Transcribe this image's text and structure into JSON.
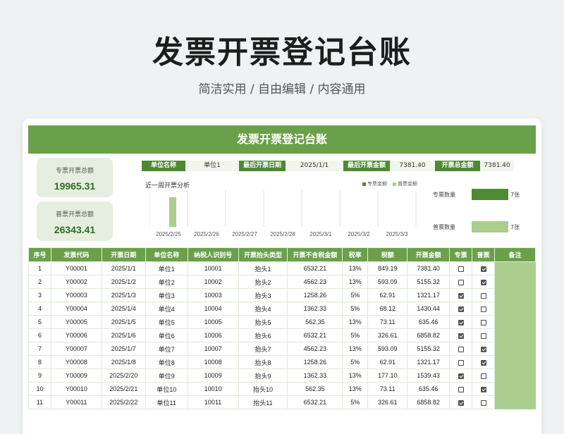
{
  "page": {
    "title": "发票开票登记台账",
    "subtitle": "简洁实用 / 自由编辑 / 内容通用"
  },
  "card": {
    "header": "发票开票登记台账",
    "summary": [
      {
        "label": "专票开票总额",
        "value": "19965.31"
      },
      {
        "label": "普票开票总额",
        "value": "26343.41"
      }
    ],
    "info": [
      {
        "key": "单位名称",
        "value": "单位1"
      },
      {
        "key": "最后开票日期",
        "value": "2025/1/1"
      },
      {
        "key": "最后开票金额",
        "value": "7381.40"
      },
      {
        "key": "开票总金额",
        "value": "7381.40"
      }
    ],
    "stats": [
      {
        "label": "专票数量",
        "value": "7张",
        "count": 7
      },
      {
        "label": "普票数量",
        "value": "7张",
        "count": 7
      }
    ]
  },
  "colors": {
    "header_green": "#6aa04a",
    "dark_green": "#4e8a34",
    "light_green": "#a9ce8d",
    "pale_green": "#e6efdf"
  },
  "chart_data": {
    "type": "bar",
    "title": "近一周开票分析",
    "categories": [
      "2025/2/25",
      "2025/2/26",
      "2025/2/27",
      "2025/2/28",
      "2025/3/1",
      "2025/3/2",
      "2025/3/3"
    ],
    "series": [
      {
        "name": "专票金额",
        "color": "#4e8a34",
        "values": [
          0,
          0,
          0,
          0,
          0,
          0,
          0
        ]
      },
      {
        "name": "普票金额",
        "color": "#a9ce8d",
        "values": [
          1,
          0,
          0,
          0,
          0,
          0,
          0
        ]
      }
    ],
    "ylim": [
      0,
      1
    ],
    "grid": true,
    "legend": "top-right"
  },
  "table": {
    "headers": [
      "序号",
      "发票代码",
      "开票日期",
      "单位名称",
      "纳税人识别号",
      "开票抬头类型",
      "开票不含税金额",
      "税率",
      "税额",
      "开票金额",
      "专票",
      "普票",
      "备注"
    ],
    "rows": [
      {
        "no": "1",
        "code": "Y00001",
        "date": "2025/1/1",
        "unit": "单位1",
        "tax_id": "10001",
        "head": "抬头1",
        "amount_ex": "6532.21",
        "rate": "13%",
        "tax": "849.19",
        "amount": "7381.40",
        "special": false,
        "normal": true,
        "note": ""
      },
      {
        "no": "2",
        "code": "Y00002",
        "date": "2025/1/2",
        "unit": "单位2",
        "tax_id": "10002",
        "head": "抬头2",
        "amount_ex": "4562.23",
        "rate": "13%",
        "tax": "593.09",
        "amount": "5155.32",
        "special": false,
        "normal": true,
        "note": ""
      },
      {
        "no": "3",
        "code": "Y00003",
        "date": "2025/1/3",
        "unit": "单位3",
        "tax_id": "10003",
        "head": "抬头3",
        "amount_ex": "1258.26",
        "rate": "5%",
        "tax": "62.91",
        "amount": "1321.17",
        "special": true,
        "normal": false,
        "note": ""
      },
      {
        "no": "4",
        "code": "Y00004",
        "date": "2025/1/4",
        "unit": "单位4",
        "tax_id": "10004",
        "head": "抬头4",
        "amount_ex": "1362.33",
        "rate": "5%",
        "tax": "68.12",
        "amount": "1430.44",
        "special": true,
        "normal": false,
        "note": ""
      },
      {
        "no": "5",
        "code": "Y00005",
        "date": "2025/1/5",
        "unit": "单位5",
        "tax_id": "10005",
        "head": "抬头5",
        "amount_ex": "562.35",
        "rate": "13%",
        "tax": "73.11",
        "amount": "635.46",
        "special": true,
        "normal": false,
        "note": ""
      },
      {
        "no": "6",
        "code": "Y00006",
        "date": "2025/1/6",
        "unit": "单位6",
        "tax_id": "10006",
        "head": "抬头6",
        "amount_ex": "6532.21",
        "rate": "5%",
        "tax": "326.61",
        "amount": "6858.82",
        "special": true,
        "normal": false,
        "note": ""
      },
      {
        "no": "7",
        "code": "Y00007",
        "date": "2025/1/7",
        "unit": "单位7",
        "tax_id": "10007",
        "head": "抬头7",
        "amount_ex": "4562.23",
        "rate": "13%",
        "tax": "593.09",
        "amount": "5155.32",
        "special": false,
        "normal": true,
        "note": ""
      },
      {
        "no": "8",
        "code": "Y00008",
        "date": "2025/1/8",
        "unit": "单位8",
        "tax_id": "10008",
        "head": "抬头8",
        "amount_ex": "1258.26",
        "rate": "5%",
        "tax": "62.91",
        "amount": "1321.17",
        "special": false,
        "normal": true,
        "note": ""
      },
      {
        "no": "9",
        "code": "Y00009",
        "date": "2025/2/20",
        "unit": "单位9",
        "tax_id": "10009",
        "head": "抬头9",
        "amount_ex": "1362.33",
        "rate": "13%",
        "tax": "177.10",
        "amount": "1539.43",
        "special": true,
        "normal": false,
        "note": ""
      },
      {
        "no": "10",
        "code": "Y00010",
        "date": "2025/2/21",
        "unit": "单位10",
        "tax_id": "10010",
        "head": "抬头10",
        "amount_ex": "562.35",
        "rate": "13%",
        "tax": "73.11",
        "amount": "635.46",
        "special": false,
        "normal": true,
        "note": ""
      },
      {
        "no": "11",
        "code": "Y00011",
        "date": "2025/2/22",
        "unit": "单位11",
        "tax_id": "10011",
        "head": "抬头11",
        "amount_ex": "6532.21",
        "rate": "5%",
        "tax": "326.61",
        "amount": "6858.82",
        "special": true,
        "normal": false,
        "note": ""
      }
    ]
  }
}
